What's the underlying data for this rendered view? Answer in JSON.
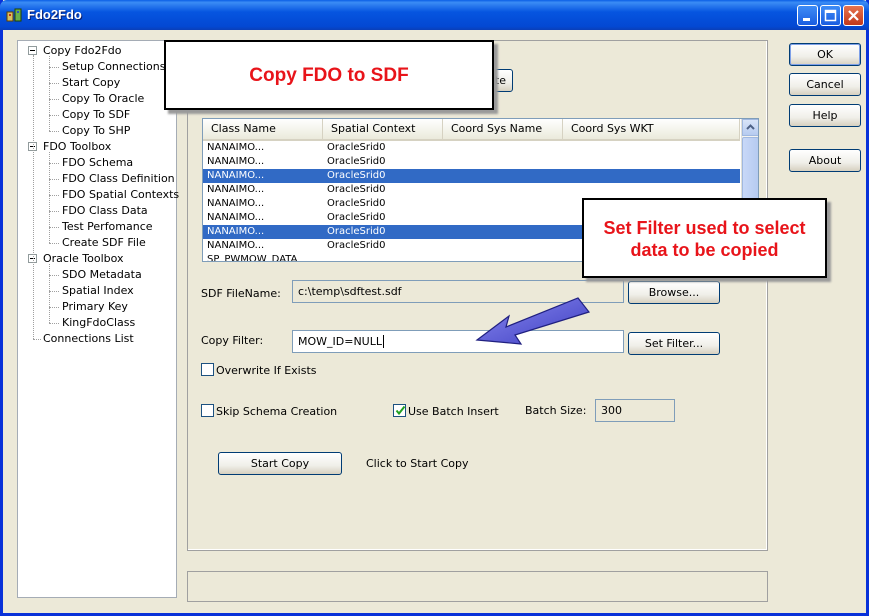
{
  "window": {
    "title": "Fdo2Fdo",
    "colors": {
      "titlebar": "#0348d3",
      "face": "#ece9d8",
      "selection": "#316ac5",
      "callout_text": "#e8141a",
      "arrow": "#5a5ad6"
    }
  },
  "tree": [
    {
      "label": "Copy Fdo2Fdo",
      "level": 0,
      "expander": true
    },
    {
      "label": "Setup Connections",
      "level": 1
    },
    {
      "label": "Start Copy",
      "level": 1
    },
    {
      "label": "Copy To Oracle",
      "level": 1
    },
    {
      "label": "Copy To SDF",
      "level": 1
    },
    {
      "label": "Copy To SHP",
      "level": 1
    },
    {
      "label": "FDO Toolbox",
      "level": 0,
      "expander": true
    },
    {
      "label": "FDO Schema",
      "level": 1
    },
    {
      "label": "FDO Class Definition",
      "level": 1
    },
    {
      "label": "FDO Spatial Contexts",
      "level": 1
    },
    {
      "label": "FDO Class Data",
      "level": 1
    },
    {
      "label": "Test Perfomance",
      "level": 1
    },
    {
      "label": "Create SDF File",
      "level": 1
    },
    {
      "label": "Oracle Toolbox",
      "level": 0,
      "expander": true
    },
    {
      "label": "SDO Metadata",
      "level": 1
    },
    {
      "label": "Spatial Index",
      "level": 1
    },
    {
      "label": "Primary Key",
      "level": 1
    },
    {
      "label": "KingFdoClass",
      "level": 1
    },
    {
      "label": "Connections List",
      "level": 0,
      "expander": false
    }
  ],
  "side_buttons": {
    "ok": "OK",
    "cancel": "Cancel",
    "help": "Help",
    "about": "About"
  },
  "hidden_button_fragment": "te",
  "grid": {
    "columns": [
      "Class Name",
      "Spatial Context",
      "Coord Sys Name",
      "Coord Sys WKT"
    ],
    "rows": [
      {
        "class_name": "NANAIMO...",
        "spatial_context": "OracleSrid0",
        "selected": false
      },
      {
        "class_name": "NANAIMO...",
        "spatial_context": "OracleSrid0",
        "selected": false
      },
      {
        "class_name": "NANAIMO...",
        "spatial_context": "OracleSrid0",
        "selected": true
      },
      {
        "class_name": "NANAIMO...",
        "spatial_context": "OracleSrid0",
        "selected": false
      },
      {
        "class_name": "NANAIMO...",
        "spatial_context": "OracleSrid0",
        "selected": false
      },
      {
        "class_name": "NANAIMO...",
        "spatial_context": "OracleSrid0",
        "selected": false
      },
      {
        "class_name": "NANAIMO...",
        "spatial_context": "OracleSrid0",
        "selected": true
      },
      {
        "class_name": "NANAIMO...",
        "spatial_context": "OracleSrid0",
        "selected": false
      },
      {
        "class_name": "SP_PWMOW_DATA",
        "spatial_context": "",
        "selected": false
      }
    ]
  },
  "form": {
    "sdf_filename_label": "SDF FileName:",
    "sdf_filename_value": "c:\\temp\\sdftest.sdf",
    "browse_label": "Browse...",
    "copy_filter_label": "Copy Filter:",
    "copy_filter_value": "MOW_ID=NULL",
    "set_filter_label": "Set Filter...",
    "overwrite_label": "Overwrite If Exists",
    "overwrite_checked": false,
    "skip_schema_label": "Skip Schema Creation",
    "skip_schema_checked": false,
    "use_batch_label": "Use Batch Insert",
    "use_batch_checked": true,
    "batch_size_label": "Batch Size:",
    "batch_size_value": "300",
    "start_copy_label": "Start Copy",
    "start_copy_hint": "Click to Start Copy"
  },
  "callouts": {
    "title": "Copy FDO to SDF",
    "filter_line1": "Set Filter used to select",
    "filter_line2": "data to be copied"
  }
}
